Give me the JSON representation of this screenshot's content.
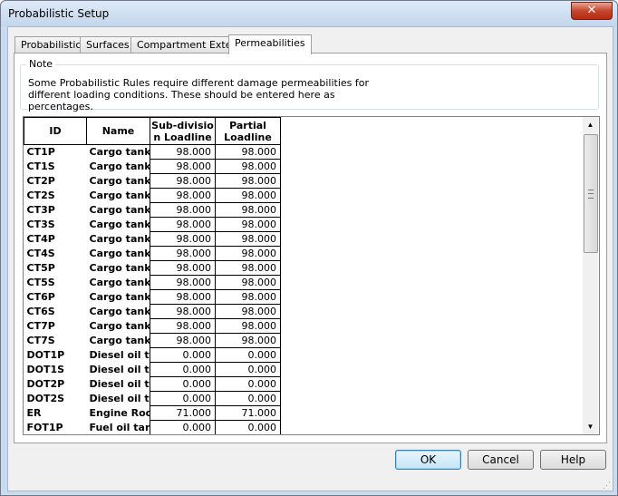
{
  "window": {
    "title": "Probabilistic Setup",
    "close_glyph": "✕"
  },
  "tabs": [
    "Probabilistic",
    "Surfaces",
    "Compartment Extents",
    "Permeabilities"
  ],
  "active_tab": "Permeabilities",
  "note": {
    "title": "Note",
    "text": "Some Probabilistic Rules require different damage permeabilities for different loading conditions. These should be entered here as percentages."
  },
  "grid": {
    "columns": [
      "ID",
      "Name",
      "Sub-divisio n Loadline",
      "Partial Loadline"
    ],
    "rows": [
      [
        "CT1P",
        "Cargo tank",
        "98.000",
        "98.000"
      ],
      [
        "CT1S",
        "Cargo tank",
        "98.000",
        "98.000"
      ],
      [
        "CT2P",
        "Cargo tank",
        "98.000",
        "98.000"
      ],
      [
        "CT2S",
        "Cargo tank",
        "98.000",
        "98.000"
      ],
      [
        "CT3P",
        "Cargo tank",
        "98.000",
        "98.000"
      ],
      [
        "CT3S",
        "Cargo tank",
        "98.000",
        "98.000"
      ],
      [
        "CT4P",
        "Cargo tank",
        "98.000",
        "98.000"
      ],
      [
        "CT4S",
        "Cargo tank",
        "98.000",
        "98.000"
      ],
      [
        "CT5P",
        "Cargo tank",
        "98.000",
        "98.000"
      ],
      [
        "CT5S",
        "Cargo tank",
        "98.000",
        "98.000"
      ],
      [
        "CT6P",
        "Cargo tank",
        "98.000",
        "98.000"
      ],
      [
        "CT6S",
        "Cargo tank",
        "98.000",
        "98.000"
      ],
      [
        "CT7P",
        "Cargo tank",
        "98.000",
        "98.000"
      ],
      [
        "CT7S",
        "Cargo tank",
        "98.000",
        "98.000"
      ],
      [
        "DOT1P",
        "Diesel oil ta",
        "0.000",
        "0.000"
      ],
      [
        "DOT1S",
        "Diesel oil ta",
        "0.000",
        "0.000"
      ],
      [
        "DOT2P",
        "Diesel oil ta",
        "0.000",
        "0.000"
      ],
      [
        "DOT2S",
        "Diesel oil ta",
        "0.000",
        "0.000"
      ],
      [
        "ER",
        "Engine Roo",
        "71.000",
        "71.000"
      ],
      [
        "FOT1P",
        "Fuel oil tan",
        "0.000",
        "0.000"
      ]
    ]
  },
  "scrollbar": {
    "up_glyph": "▲",
    "down_glyph": "▼"
  },
  "buttons": {
    "ok": "OK",
    "cancel": "Cancel",
    "help": "Help"
  }
}
